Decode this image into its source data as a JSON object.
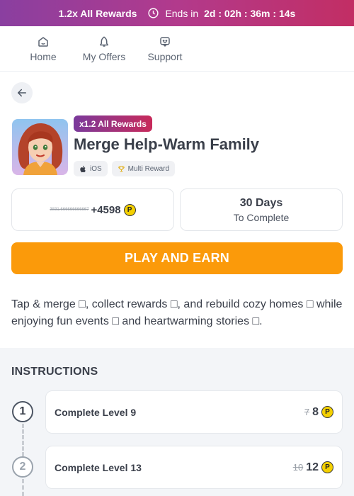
{
  "banner": {
    "multiplier": "1.2x All Rewards",
    "ends_label": "Ends in",
    "timer": "2d : 02h : 36m : 14s"
  },
  "nav": {
    "items": [
      {
        "label": "Home",
        "icon": "home-icon"
      },
      {
        "label": "My Offers",
        "icon": "offers-icon"
      },
      {
        "label": "Support",
        "icon": "support-icon"
      }
    ]
  },
  "offer": {
    "reward_chip": "x1.2 All Rewards",
    "title": "Merge Help-Warm Family",
    "tags": [
      {
        "label": "iOS",
        "icon": "apple-icon"
      },
      {
        "label": "Multi Reward",
        "icon": "trophy-icon"
      }
    ],
    "points_old": "3831.666666666667",
    "points_new": "+4598",
    "coin_symbol": "P",
    "days_value": "30 Days",
    "days_label": "To Complete",
    "cta": "PLAY AND EARN",
    "description": "Tap & merge □, collect rewards □, and rebuild cozy homes □ while enjoying fun events □ and heartwarming stories □."
  },
  "instructions": {
    "heading": "INSTRUCTIONS",
    "steps": [
      {
        "number": "1",
        "label": "Complete Level 9",
        "old_reward": "7",
        "new_reward": "8"
      },
      {
        "number": "2",
        "label": "Complete Level 13",
        "old_reward": "10",
        "new_reward": "12"
      }
    ]
  },
  "colors": {
    "accent": "#fb9a0a",
    "banner_start": "#8a3fa0",
    "banner_end": "#c22e64",
    "coin": "#f4d000"
  }
}
